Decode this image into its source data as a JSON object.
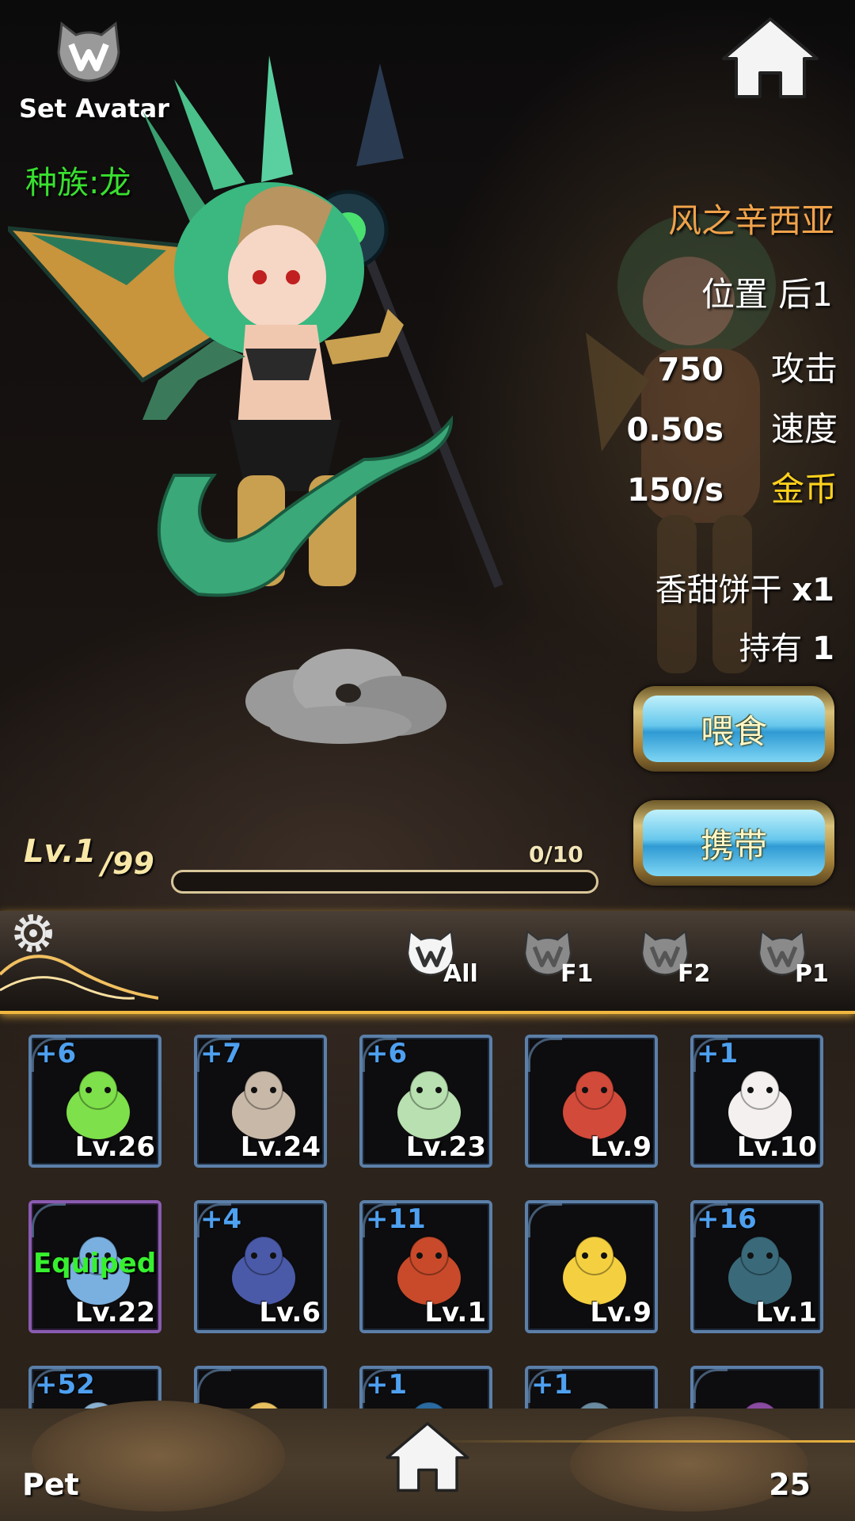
{
  "header": {
    "set_avatar": "Set Avatar",
    "race": "种族:龙"
  },
  "pet": {
    "name": "风之辛西亚",
    "position_label": "位置 后1",
    "attack": {
      "value": "750",
      "label": "攻击"
    },
    "speed": {
      "value": "0.50s",
      "label": "速度"
    },
    "gold": {
      "value": "150/s",
      "label": "金币"
    },
    "food_name": "香甜饼干",
    "food_qty": "x1",
    "owned_label": "持有",
    "owned_count": "1"
  },
  "actions": {
    "feed_label": "喂食",
    "carry_label": "携带"
  },
  "level": {
    "current": "Lv.1",
    "max": "/99",
    "xp_text": "0/10",
    "xp_fraction": 0
  },
  "filters": [
    {
      "label": "All",
      "active": true
    },
    {
      "label": "F1",
      "active": false
    },
    {
      "label": "F2",
      "active": false
    },
    {
      "label": "P1",
      "active": false
    }
  ],
  "pets": [
    {
      "plus": "+6",
      "level": "Lv.26",
      "equipped": "",
      "color": "#7ee04a",
      "icon": "green-slime-icon"
    },
    {
      "plus": "+7",
      "level": "Lv.24",
      "equipped": "",
      "color": "#c8b8a8",
      "icon": "skeleton-icon"
    },
    {
      "plus": "+6",
      "level": "Lv.23",
      "equipped": "",
      "color": "#b8e0b0",
      "icon": "rabbit-icon"
    },
    {
      "plus": "",
      "level": "Lv.9",
      "equipped": "",
      "color": "#d24a3a",
      "icon": "mushroom-icon"
    },
    {
      "plus": "+1",
      "level": "Lv.10",
      "equipped": "",
      "color": "#f4f0f0",
      "icon": "ghost-icon"
    },
    {
      "plus": "",
      "level": "Lv.22",
      "equipped": "Equiped",
      "color": "#7ab0e0",
      "icon": "fairy-icon"
    },
    {
      "plus": "+4",
      "level": "Lv.6",
      "equipped": "",
      "color": "#4a5aa8",
      "icon": "fly-icon"
    },
    {
      "plus": "+11",
      "level": "Lv.1",
      "equipped": "",
      "color": "#c84a2a",
      "icon": "dragon-hood-icon"
    },
    {
      "plus": "",
      "level": "Lv.9",
      "equipped": "",
      "color": "#f4d040",
      "icon": "chick-icon"
    },
    {
      "plus": "+16",
      "level": "Lv.1",
      "equipped": "",
      "color": "#3a6a7a",
      "icon": "crab-icon"
    },
    {
      "plus": "+52",
      "level": "",
      "equipped": "",
      "color": "#8ab0d0",
      "icon": "pet-icon"
    },
    {
      "plus": "",
      "level": "",
      "equipped": "",
      "color": "#e8c060",
      "icon": "pet-icon"
    },
    {
      "plus": "+1",
      "level": "",
      "equipped": "",
      "color": "#2a6aa0",
      "icon": "pet-icon"
    },
    {
      "plus": "+1",
      "level": "",
      "equipped": "",
      "color": "#6a8aa0",
      "icon": "pet-icon"
    },
    {
      "plus": "",
      "level": "",
      "equipped": "",
      "color": "#8a4aa0",
      "icon": "pet-icon"
    }
  ],
  "footer": {
    "tab_label": "Pet",
    "count": "25"
  }
}
